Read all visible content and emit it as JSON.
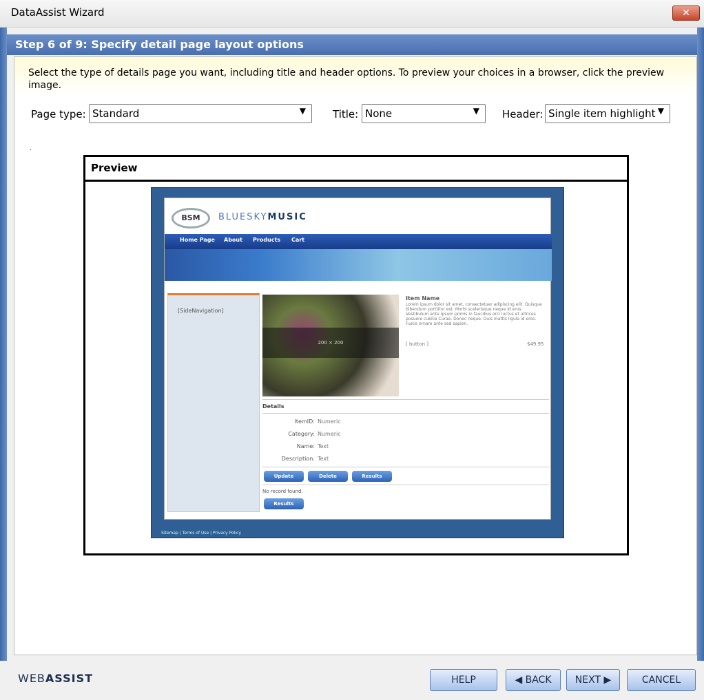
{
  "window": {
    "title": "DataAssist Wizard",
    "close_symbol": "✕"
  },
  "step": {
    "title": "Step 6 of 9: Specify detail page layout options"
  },
  "instructions": "Select the type of details page you want, including title and header options. To preview your choices in a browser, click the preview image.",
  "options": {
    "page_type_label": "Page type:",
    "page_type_value": "Standard",
    "title_label": "Title:",
    "title_value": "None",
    "header_label": "Header:",
    "header_value": "Single item highlight"
  },
  "preview": {
    "heading": "Preview",
    "mock": {
      "logo_badge": "BSM",
      "logo_light": "BLUESKY",
      "logo_bold": "MUSIC",
      "nav": [
        "Home Page",
        "About",
        "Products",
        "Cart"
      ],
      "side_nav": "[SideNavigation]",
      "photo_label": "200 × 200",
      "item_name": "Item Name",
      "item_desc": "Lorem ipsum dolor sit amet, consectetuer adipiscing elit. Quisque bibendum porttitor est. Morbi scelerisque neque id eros. Vestibulum ante ipsum primis in faucibus orci luctus et ultrices posuere cubilia Curae. Donec neque. Duis mattis ligula id eros. Fusce ornare ante sed sapien.",
      "item_button": "[ button ]",
      "item_price": "$49.95",
      "details_title": "Details",
      "details": [
        {
          "label": "ItemID:",
          "value": "Numeric"
        },
        {
          "label": "Category:",
          "value": "Numeric"
        },
        {
          "label": "Name:",
          "value": "Text"
        },
        {
          "label": "Description:",
          "value": "Text"
        }
      ],
      "btn_update": "Update",
      "btn_delete": "Delete",
      "btn_results": "Results",
      "no_record": "No record found.",
      "btn_results2": "Results",
      "footer_links": "Sitemap | Terms of Use | Privacy Policy"
    }
  },
  "footer": {
    "brand_light": "WEB",
    "brand_bold": "ASSIST",
    "help": "HELP",
    "back": "◀ BACK",
    "next": "NEXT ▶",
    "cancel": "CANCEL"
  }
}
